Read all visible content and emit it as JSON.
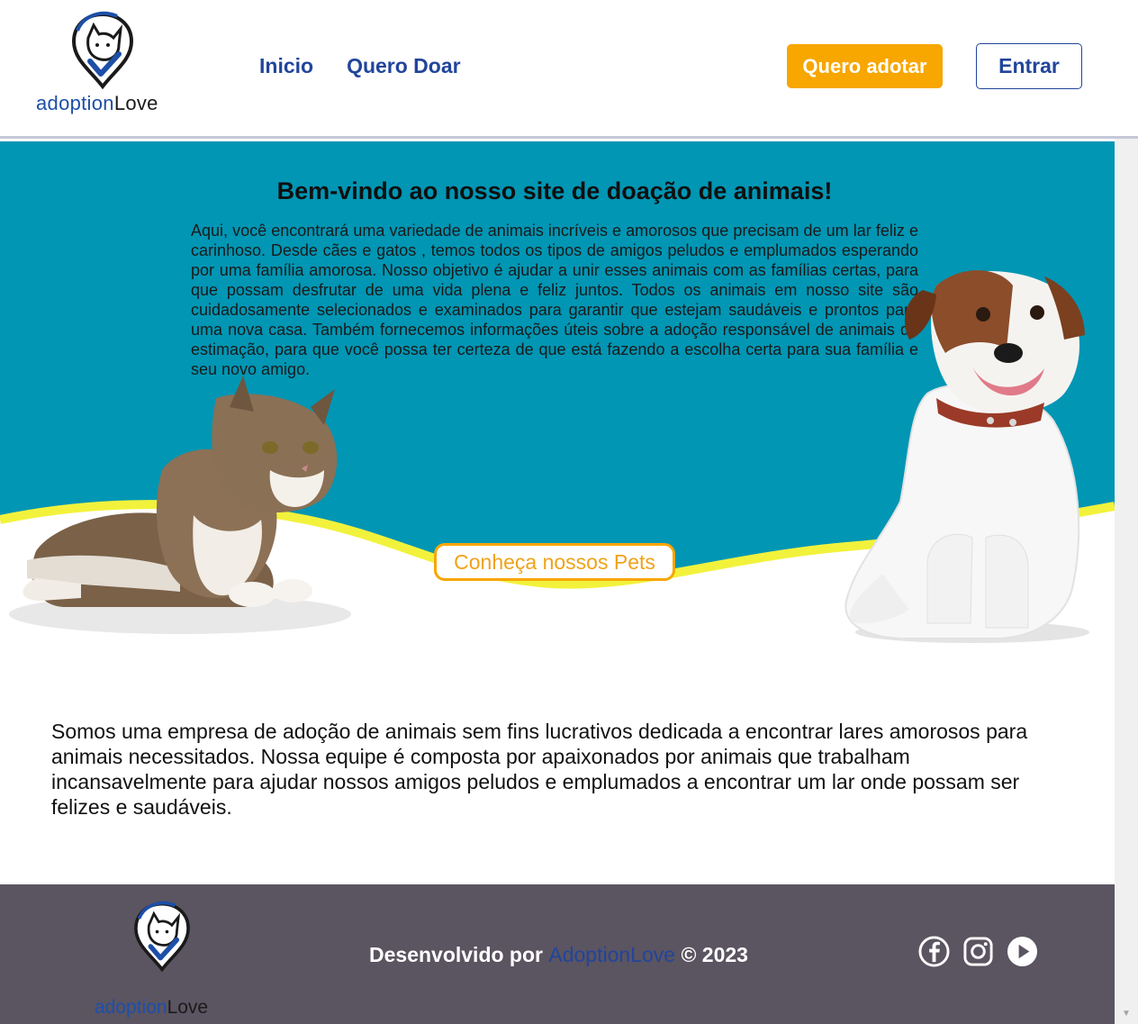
{
  "header": {
    "logo": {
      "part1": "adoption",
      "part2": "Love"
    },
    "nav": [
      {
        "label": "Inicio"
      },
      {
        "label": "Quero Doar"
      }
    ],
    "adopt_button": "Quero adotar",
    "login_button": "Entrar"
  },
  "hero": {
    "title": "Bem-vindo ao nosso site de doação de animais!",
    "text": "Aqui, você encontrará uma variedade de animais incríveis e amorosos que precisam de um lar feliz e carinhoso. Desde cães e gatos , temos todos os tipos de amigos peludos e emplumados esperando por uma família amorosa. Nosso objetivo é ajudar a unir esses animais com as famílias certas, para que possam desfrutar de uma vida plena e feliz juntos. Todos os animais em nosso site são cuidadosamente selecionados e examinados para garantir que estejam saudáveis e prontos para uma nova casa. Também fornecemos informações úteis sobre a adoção responsável de animais de estimação, para que você possa ter certeza de que está fazendo a escolha certa para sua família e seu novo amigo.",
    "cta": "Conheça nossos Pets"
  },
  "about": {
    "text": "Somos uma empresa de adoção de animais sem fins lucrativos dedicada a encontrar lares amorosos para animais necessitados. Nossa equipe é composta por apaixonados por animais que trabalham incansavelmente para ajudar nossos amigos peludos e emplumados a encontrar um lar onde possam ser felizes e saudáveis."
  },
  "footer": {
    "logo": {
      "part1": "adoption",
      "part2": "Love"
    },
    "credit_prefix": "Desenvolvido por ",
    "credit_brand": "AdoptionLove",
    "credit_suffix": " © 2023",
    "socials": [
      {
        "icon": "facebook-icon"
      },
      {
        "icon": "instagram-icon"
      },
      {
        "icon": "youtube-icon"
      }
    ]
  },
  "colors": {
    "brand_blue": "#21459b",
    "accent_orange": "#f8a600",
    "hero_teal": "#0096b4",
    "wave_yellow": "#f2f23c",
    "footer_bg": "#5b5461"
  }
}
